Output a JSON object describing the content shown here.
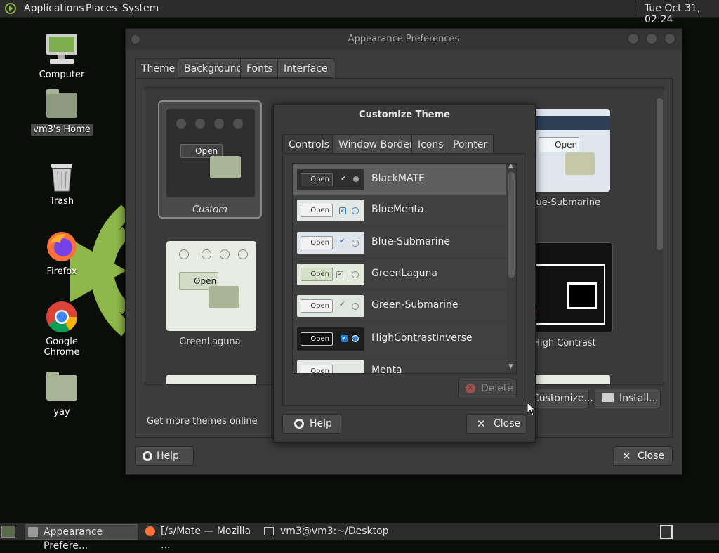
{
  "top_panel": {
    "menus": [
      "Applications",
      "Places",
      "System"
    ],
    "clock": "Tue Oct 31, 02:24"
  },
  "desktop": {
    "icons": [
      "Computer",
      "vm3's Home",
      "Trash",
      "Firefox",
      "Google Chrome",
      "yay"
    ]
  },
  "appearance_window": {
    "title": "Appearance Preferences",
    "tabs": [
      "Theme",
      "Background",
      "Fonts",
      "Interface"
    ],
    "themes_visible": [
      "Custom",
      "GreenLaguna",
      "Blue-Submarine",
      "High Contrast"
    ],
    "preview_open_label": "Open",
    "get_more_link": "Get more themes online",
    "customize_button": "Customize...",
    "install_button": "Install...",
    "help_button": "Help",
    "close_button": "Close"
  },
  "customize_dialog": {
    "title": "Customize Theme",
    "tabs": [
      "Controls",
      "Window Border",
      "Icons",
      "Pointer"
    ],
    "themes": [
      "BlackMATE",
      "BlueMenta",
      "Blue-Submarine",
      "GreenLaguna",
      "Green-Submarine",
      "HighContrastInverse",
      "Menta"
    ],
    "selected_index": 0,
    "row_open_label": "Open",
    "delete_button": "Delete",
    "help_button": "Help",
    "close_button": "Close"
  },
  "taskbar": {
    "items": [
      "Appearance Prefere...",
      "[/s/Mate — Mozilla ...",
      "vm3@vm3:~/Desktop"
    ]
  },
  "colors": {
    "panel_bg": "#2b2b2b",
    "window_bg": "#3c3c3c",
    "selection_bg": "#5e5e5e",
    "desktop_accent": "#8fb84a",
    "check_blue": "#2a7fd4"
  }
}
